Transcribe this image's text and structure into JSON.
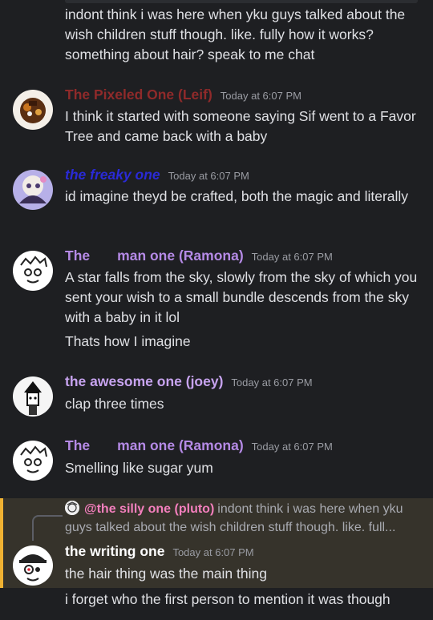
{
  "messages": [
    {
      "id": "m0",
      "text": "indont think i was here when yku guys talked about the wish children stuff though. like. fully how it works? something about hair? speak to me chat"
    },
    {
      "id": "m1",
      "author": "The Pixeled One (Leif)",
      "author_color": "#8f2a2a",
      "timestamp": "Today at 6:07 PM",
      "text": "I think it started with someone saying Sif went to a Favor Tree and came back with a baby"
    },
    {
      "id": "m2",
      "author": "the freaky one",
      "author_color": "#2a2ad6",
      "timestamp": "Today at 6:07 PM",
      "text": "id imagine theyd be crafted, both the magic and literally"
    },
    {
      "id": "m3",
      "author": "The       man one (Ramona)",
      "author_color": "#b58ae6",
      "timestamp": "Today at 6:07 PM",
      "text": "A star falls from the sky, slowly from the sky of which you sent your wish to a small bundle descends from the sky with a baby in it lol",
      "followup": "Thats how I imagine"
    },
    {
      "id": "m4",
      "author": "the awesome one (joey)",
      "author_color": "#c7a3ef",
      "timestamp": "Today at 6:07 PM",
      "text": "clap three times"
    },
    {
      "id": "m5",
      "author": "The       man one (Ramona)",
      "author_color": "#b58ae6",
      "timestamp": "Today at 6:07 PM",
      "text": "Smelling like sugar yum"
    },
    {
      "id": "m6",
      "reply_to": {
        "author": "@the silly one (pluto)",
        "text": "indont think i was here when yku guys talked about the wish children stuff though. like. full..."
      },
      "author": "the writing one",
      "author_color": "#ffffff",
      "timestamp": "Today at 6:07 PM",
      "text": "the hair thing was the main thing",
      "followup": "i forget who the first person to mention it was though"
    }
  ],
  "colors": {
    "background": "#1e1f22",
    "highlight": "#36332b",
    "highlight_bar": "#f0b232",
    "mention": "#f47fbd"
  }
}
